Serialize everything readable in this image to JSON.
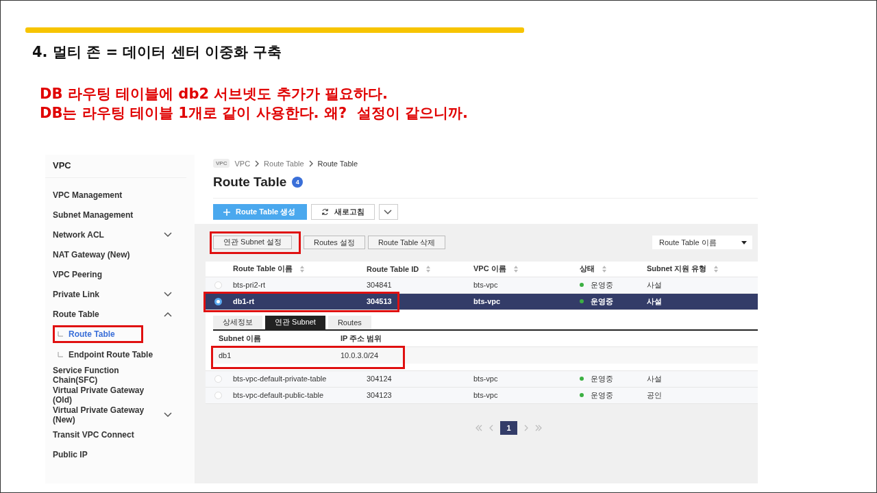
{
  "slide": {
    "title": "4. 멀티 존 = 데이터 센터 이중화 구축",
    "notes": [
      "DB 라우팅 테이블에 db2 서브넷도 추가가 필요하다.",
      "DB는 라우팅 테이블 1개로 같이 사용한다. 왜?  설정이 같으니까."
    ]
  },
  "sidebar": {
    "title": "VPC",
    "items": [
      {
        "label": "VPC Management",
        "selected": false
      },
      {
        "label": "Subnet Management",
        "selected": false
      },
      {
        "label": "Network ACL",
        "selected": false,
        "expanded": false
      },
      {
        "label": "NAT Gateway (New)",
        "selected": false
      },
      {
        "label": "VPC Peering",
        "selected": false
      },
      {
        "label": "Private Link",
        "selected": false,
        "expanded": false
      },
      {
        "label": "Route Table",
        "selected": false,
        "expanded": true,
        "children": [
          {
            "label": "Route Table",
            "selected": true,
            "highlighted": true
          },
          {
            "label": "Endpoint Route Table",
            "selected": false,
            "highlighted": false
          }
        ]
      },
      {
        "label": "Service Function Chain(SFC)",
        "selected": false
      },
      {
        "label": "Virtual Private Gateway (Old)",
        "selected": false
      },
      {
        "label": "Virtual Private Gateway (New)",
        "selected": false,
        "expanded": false
      },
      {
        "label": "Transit VPC Connect",
        "selected": false
      },
      {
        "label": "Public IP",
        "selected": false
      }
    ]
  },
  "breadcrumb": {
    "badge": "VPC",
    "items": [
      "VPC",
      "Route Table",
      "Route Table"
    ]
  },
  "page": {
    "title": "Route Table",
    "count": "4"
  },
  "toolbar": {
    "create": "Route Table 생성",
    "refresh": "새로고침"
  },
  "actions": [
    {
      "label": "연관 Subnet 설정",
      "highlighted": true
    },
    {
      "label": "Routes 설정",
      "highlighted": false
    },
    {
      "label": "Route Table 삭제",
      "highlighted": false
    }
  ],
  "filter": {
    "value": "Route Table 이름"
  },
  "table": {
    "columns": [
      "Route Table 이름",
      "Route Table ID",
      "VPC 이름",
      "상태",
      "Subnet 지원 유형"
    ],
    "rows": [
      {
        "name": "bts-pri2-rt",
        "id": "304841",
        "vpc": "bts-vpc",
        "status": "운영중",
        "color": "#3cb043",
        "type": "사설",
        "selected": false,
        "highlighted": false
      },
      {
        "name": "db1-rt",
        "id": "304513",
        "vpc": "bts-vpc",
        "status": "운영중",
        "color": "#3cb043",
        "type": "사설",
        "selected": true,
        "highlighted": true
      },
      {
        "name": "bts-vpc-default-private-table",
        "id": "304124",
        "vpc": "bts-vpc",
        "status": "운영중",
        "color": "#3cb043",
        "type": "사설",
        "selected": false,
        "highlighted": false
      },
      {
        "name": "bts-vpc-default-public-table",
        "id": "304123",
        "vpc": "bts-vpc",
        "status": "운영중",
        "color": "#3cb043",
        "type": "공인",
        "selected": false,
        "highlighted": false
      }
    ]
  },
  "detail": {
    "tabs": [
      {
        "label": "상세정보",
        "selected": false
      },
      {
        "label": "연관 Subnet",
        "selected": true
      },
      {
        "label": "Routes",
        "selected": false
      }
    ],
    "columns": [
      "Subnet 이름",
      "IP 주소 범위"
    ],
    "rows": [
      {
        "name": "db1",
        "range": "10.0.3.0/24",
        "highlighted": true
      }
    ]
  },
  "pagination": {
    "pages": [
      {
        "label": "1",
        "selected": true
      }
    ]
  }
}
